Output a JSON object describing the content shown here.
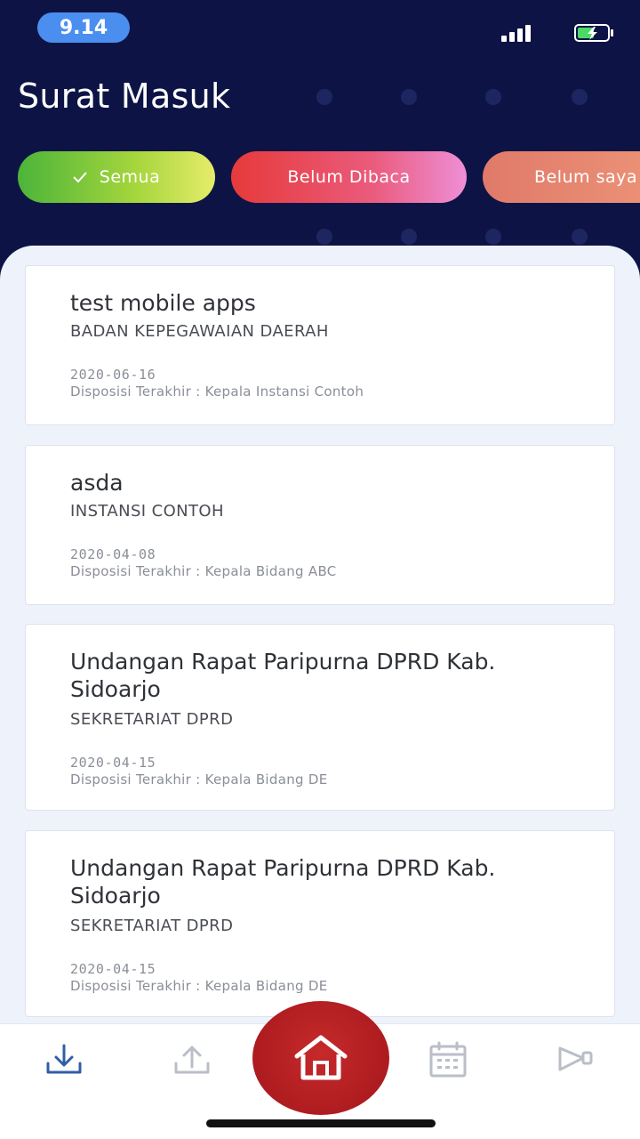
{
  "status_bar": {
    "time": "9.14",
    "signal_icon": "signal-bars-icon",
    "battery_icon": "battery-charging-icon"
  },
  "header": {
    "title": "Surat Masuk"
  },
  "filters": [
    {
      "label": "Semua",
      "selected": true,
      "icon": "check-icon"
    },
    {
      "label": "Belum Dibaca",
      "selected": false
    },
    {
      "label": "Belum saya",
      "selected": false
    }
  ],
  "letters": [
    {
      "title": "test mobile apps",
      "org": "BADAN KEPEGAWAIAN DAERAH",
      "date": "2020-06-16",
      "disposition": "Disposisi Terakhir : Kepala Instansi Contoh"
    },
    {
      "title": "asda",
      "org": "INSTANSI CONTOH",
      "date": "2020-04-08",
      "disposition": "Disposisi Terakhir : Kepala Bidang ABC"
    },
    {
      "title": "Undangan Rapat Paripurna DPRD Kab. Sidoarjo",
      "org": "SEKRETARIAT DPRD",
      "date": "2020-04-15",
      "disposition": "Disposisi Terakhir : Kepala Bidang DE"
    },
    {
      "title": "Undangan Rapat Paripurna DPRD Kab. Sidoarjo",
      "org": "SEKRETARIAT DPRD",
      "date": "2020-04-15",
      "disposition": "Disposisi Terakhir : Kepala Bidang DE"
    }
  ],
  "bottom_nav": [
    {
      "icon": "inbox-download-icon",
      "active": true
    },
    {
      "icon": "outbox-upload-icon",
      "active": false
    },
    {
      "icon": "home-icon",
      "active": false
    },
    {
      "icon": "calendar-icon",
      "active": false
    },
    {
      "icon": "megaphone-icon",
      "active": false
    }
  ],
  "colors": {
    "header_bg": "#0d1445",
    "accent_blue": "#4a8ff0",
    "home_red": "#b41f24",
    "active_nav": "#2f5fa8",
    "inactive_nav": "#b9bec7"
  }
}
